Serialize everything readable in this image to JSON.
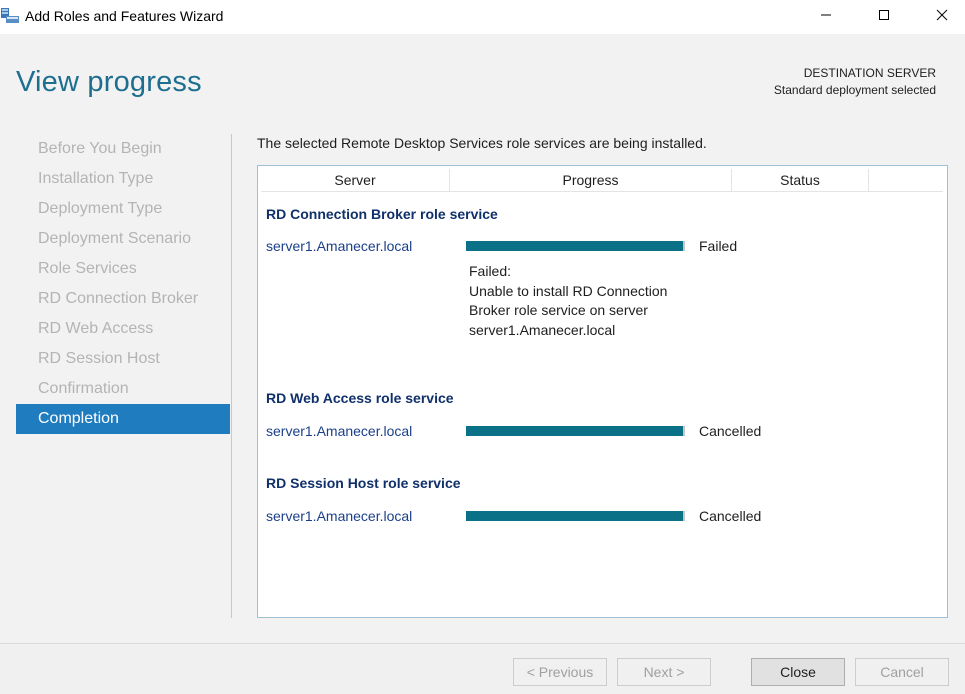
{
  "window": {
    "title": "Add Roles and Features Wizard",
    "icon": "server-manager-icon"
  },
  "header": {
    "page_title": "View progress",
    "destination_label": "DESTINATION SERVER",
    "destination_value": "Standard deployment selected"
  },
  "sidebar": {
    "items": [
      {
        "label": "Before You Begin"
      },
      {
        "label": "Installation Type"
      },
      {
        "label": "Deployment Type"
      },
      {
        "label": "Deployment Scenario"
      },
      {
        "label": "Role Services"
      },
      {
        "label": "RD Connection Broker"
      },
      {
        "label": "RD Web Access"
      },
      {
        "label": "RD Session Host"
      },
      {
        "label": "Confirmation"
      },
      {
        "label": "Completion"
      }
    ],
    "active_index": 9
  },
  "main": {
    "intro": "The selected Remote Desktop Services role services are being installed.",
    "columns": {
      "server": "Server",
      "progress": "Progress",
      "status": "Status"
    },
    "groups": [
      {
        "title": "RD Connection Broker role service",
        "server": "server1.Amanecer.local",
        "progress": 1.0,
        "status": "Failed",
        "detail": [
          "Failed:",
          "Unable to install RD Connection",
          "Broker role service on server",
          "server1.Amanecer.local"
        ]
      },
      {
        "title": "RD Web Access role service",
        "server": "server1.Amanecer.local",
        "progress": 1.0,
        "status": "Cancelled"
      },
      {
        "title": "RD Session Host role service",
        "server": "server1.Amanecer.local",
        "progress": 1.0,
        "status": "Cancelled"
      }
    ]
  },
  "footer": {
    "previous": "< Previous",
    "next": "Next >",
    "close": "Close",
    "cancel": "Cancel"
  },
  "colors": {
    "accent": "#1e7cbf",
    "title": "#1e6e8f",
    "progress_fill": "#0a7187",
    "group_title": "#10306a"
  }
}
